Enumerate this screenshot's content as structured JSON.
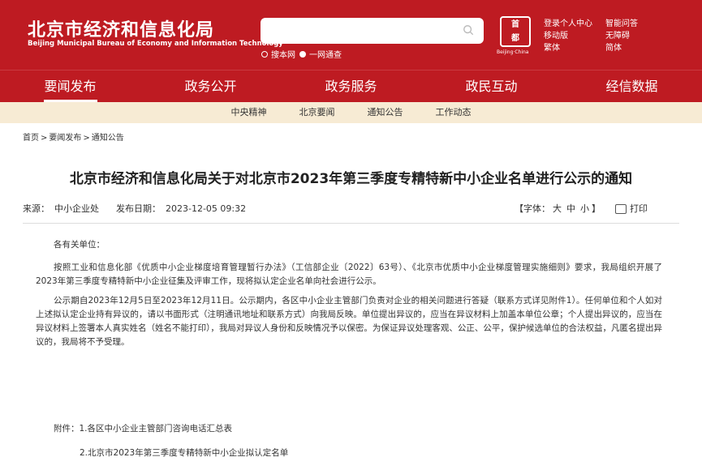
{
  "header": {
    "site_name": "北京市经济和信息化局",
    "site_name_en": "Beijing Municipal Bureau of Economy and Information Technology",
    "search_placeholder": "",
    "scope_options": [
      "搜本网",
      "一网通查"
    ],
    "emblem_chars": [
      "首",
      "都"
    ],
    "emblem_caption": "Beijing·China",
    "top_links": [
      "登录个人中心",
      "移动版",
      "繁体",
      "智能问答",
      "无障碍",
      "简体"
    ],
    "brand_color": "#be1b22"
  },
  "nav": {
    "primary": [
      "要闻发布",
      "政务公开",
      "政务服务",
      "政民互动",
      "经信数据"
    ],
    "active": "要闻发布",
    "secondary": [
      "中央精神",
      "北京要闻",
      "通知公告",
      "工作动态"
    ]
  },
  "breadcrumb": [
    "首页",
    "要闻发布",
    "通知公告"
  ],
  "breadcrumb_separator": ">",
  "article": {
    "title": "北京市经济和信息化局关于对北京市2023年第三季度专精特新中小企业名单进行公示的通知",
    "source_label": "来源：",
    "source": "中小企业处",
    "date_label": "发布日期：",
    "date": "2023-12-05 09:32",
    "font_label": "【字体：",
    "font_sizes": [
      "大",
      "中",
      "小"
    ],
    "font_close": "】",
    "print_label": "打印",
    "salutation": "各有关单位：",
    "paragraphs": [
      "按照工业和信息化部《优质中小企业梯度培育管理暂行办法》（工信部企业〔2022〕63号）、《北京市优质中小企业梯度管理实施细则》要求，我局组织开展了2023年第三季度专精特新中小企业征集及评审工作，现将拟认定企业名单向社会进行公示。",
      "公示期自2023年12月5日至2023年12月11日。公示期内，各区中小企业主管部门负责对企业的相关问题进行答疑（联系方式详见附件1）。任何单位和个人如对上述拟认定企业持有异议的，请以书面形式（注明通讯地址和联系方式）向我局反映。单位提出异议的，应当在异议材料上加盖本单位公章；个人提出异议的，应当在异议材料上签署本人真实姓名（姓名不能打印），我局对异议人身份和反映情况予以保密。为保证异议处理客观、公正、公平，保护候选单位的合法权益，凡匿名提出异议的，我局将不予受理。"
    ],
    "attachments": [
      "附件：1.各区中小企业主管部门咨询电话汇总表",
      "2.北京市2023年第三季度专精特新中小企业拟认定名单"
    ]
  }
}
